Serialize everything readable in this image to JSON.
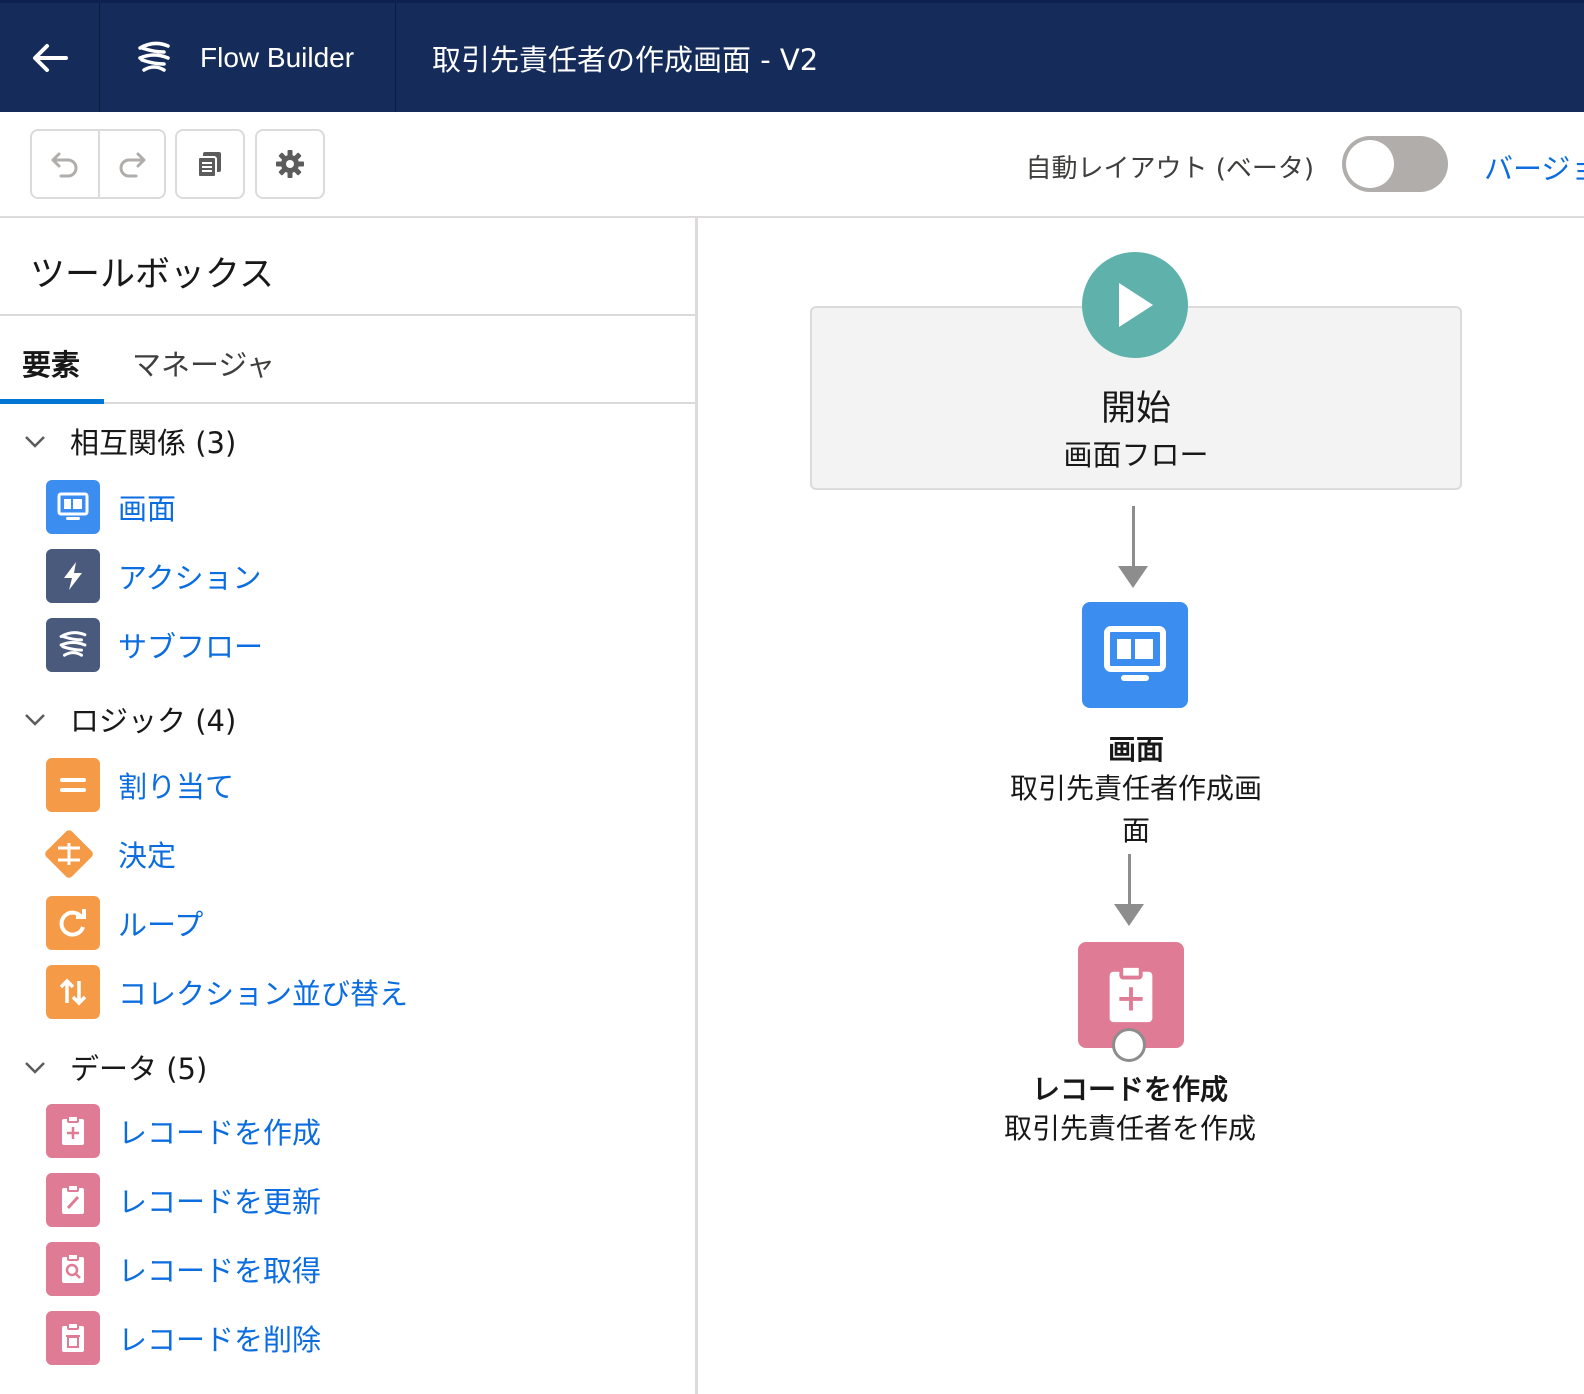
{
  "header": {
    "back_icon": "back-arrow-icon",
    "brand_logo_icon": "flow-logo-icon",
    "brand_name": "Flow Builder",
    "flow_title": "取引先責任者の作成画面 - V2",
    "background": "#152c5b"
  },
  "toolbar": {
    "undo_icon": "undo-icon",
    "redo_icon": "redo-icon",
    "copy_icon": "copy-icon",
    "settings_icon": "gear-icon",
    "auto_layout_label": "自動レイアウト (ベータ)",
    "auto_layout_on": false,
    "version_link": "バージョ"
  },
  "sidebar": {
    "title": "ツールボックス",
    "tabs": [
      {
        "label": "要素",
        "active": true
      },
      {
        "label": "マネージャ",
        "active": false
      }
    ],
    "sections": [
      {
        "label": "相互関係 (3)",
        "items": [
          {
            "label": "画面",
            "icon": "screen-icon",
            "color": "#3b8ef0"
          },
          {
            "label": "アクション",
            "icon": "lightning-icon",
            "color": "#4a5a7d"
          },
          {
            "label": "サブフロー",
            "icon": "flow-icon",
            "color": "#4a5a7d"
          }
        ]
      },
      {
        "label": "ロジック (4)",
        "items": [
          {
            "label": "割り当て",
            "icon": "assignment-icon",
            "color": "#f59b47"
          },
          {
            "label": "決定",
            "icon": "decision-icon",
            "color": "#f59b47"
          },
          {
            "label": "ループ",
            "icon": "loop-icon",
            "color": "#f59b47"
          },
          {
            "label": "コレクション並び替え",
            "icon": "sort-icon",
            "color": "#f59b47"
          }
        ]
      },
      {
        "label": "データ (5)",
        "items": [
          {
            "label": "レコードを作成",
            "icon": "record-create-icon",
            "color": "#e07b95"
          },
          {
            "label": "レコードを更新",
            "icon": "record-update-icon",
            "color": "#e07b95"
          },
          {
            "label": "レコードを取得",
            "icon": "record-lookup-icon",
            "color": "#e07b95"
          },
          {
            "label": "レコードを削除",
            "icon": "record-delete-icon",
            "color": "#e07b95"
          }
        ]
      }
    ]
  },
  "canvas": {
    "start": {
      "title": "開始",
      "subtitle": "画面フロー",
      "icon": "play-icon",
      "color": "#5eb2ab"
    },
    "nodes": [
      {
        "title": "画面",
        "subtitle_line1": "取引先責任者作成画",
        "subtitle_line2": "面",
        "icon": "screen-icon",
        "color": "#3b8ef0"
      },
      {
        "title": "レコードを作成",
        "subtitle_line1": "取引先責任者を作成",
        "icon": "record-create-icon",
        "color": "#e07b95"
      }
    ]
  }
}
